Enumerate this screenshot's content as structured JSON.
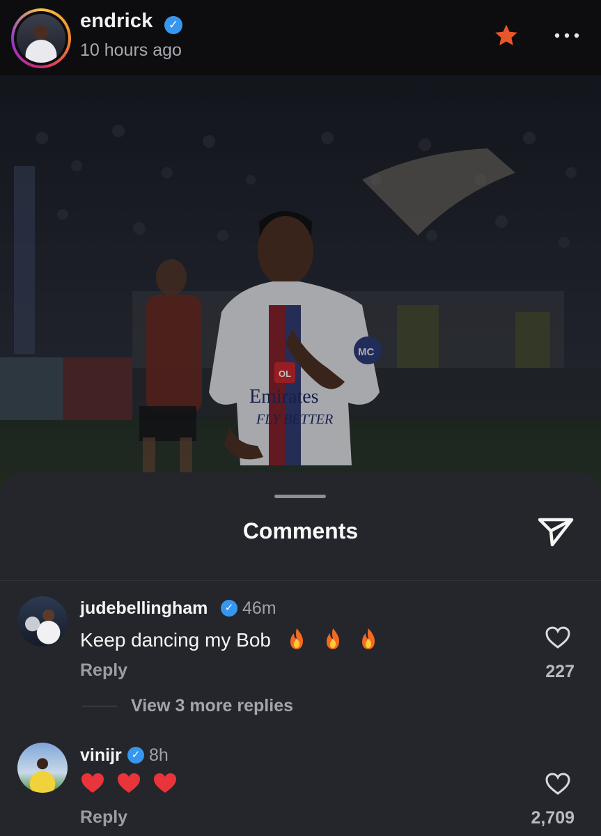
{
  "post": {
    "username": "endrick",
    "timestamp": "10 hours ago",
    "icons": {
      "verified": "verified-badge-icon",
      "favorite": "star-icon",
      "more": "more-icon"
    }
  },
  "photo": {
    "jersey_sponsor_line1": "Emirates",
    "jersey_sponsor_line2": "FLY BETTER",
    "crest": "OL",
    "sleeve_badge": "MC"
  },
  "comments_sheet": {
    "title": "Comments",
    "comments": [
      {
        "username": "judebellingham",
        "time": "46m",
        "text": "Keep dancing my Bob",
        "emojis": [
          "fire",
          "fire",
          "fire"
        ],
        "reply_label": "Reply",
        "likes": "227",
        "view_replies": "View 3 more replies"
      },
      {
        "username": "vinijr",
        "time": "8h",
        "text": "",
        "emojis": [
          "red-heart",
          "red-heart",
          "red-heart"
        ],
        "reply_label": "Reply",
        "likes": "2,709"
      }
    ]
  },
  "colors": {
    "background": "#0c0c0e",
    "sheet": "#25262b",
    "verified": "#3797f0",
    "star": "#e8572c"
  }
}
